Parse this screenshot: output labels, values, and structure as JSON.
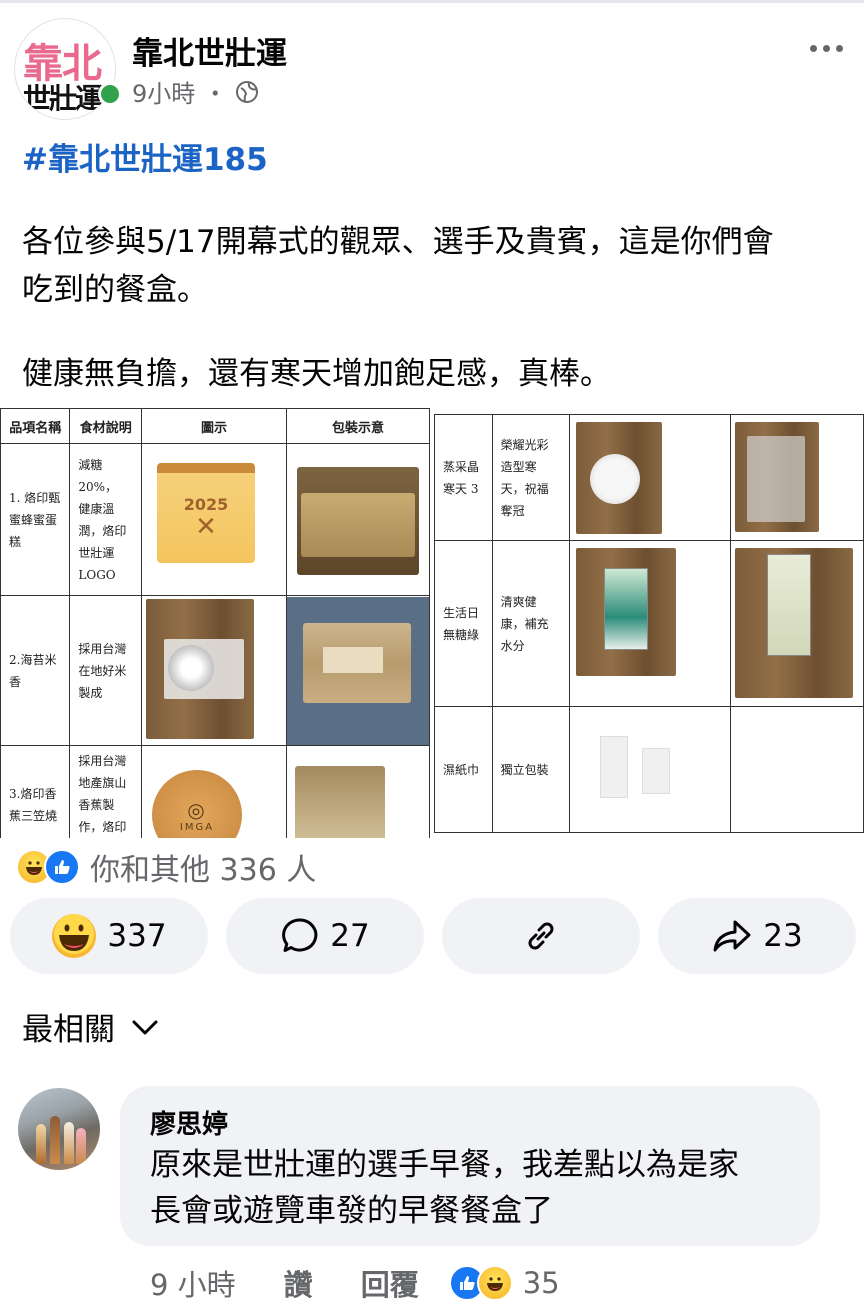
{
  "post": {
    "page_name": "靠北世壯運",
    "avatar_text_top": "靠北",
    "avatar_text_bottom": "世壯運",
    "time": "9小時",
    "dot": "・",
    "hashtag": "#靠北世壯運185",
    "paragraph1": "各位參與5/17開幕式的觀眾、選手及貴賓，這是你們會\n吃到的餐盒。",
    "paragraph2": "健康無負擔，還有寒天增加飽足感，真棒。"
  },
  "image_left": {
    "headers": [
      "品項名稱",
      "食材說明",
      "圖示",
      "包裝示意"
    ],
    "rows": [
      {
        "name": "1. 烙印甄\n蜜蜂蜜蛋糕",
        "desc": "減糖 20%，\n健康溫\n潤，烙印\n世壯運\nLOGO",
        "cake_year": "2025"
      },
      {
        "name": "2.海苔米\n香",
        "desc": "採用台灣\n在地好米\n製成"
      },
      {
        "name": "3.烙印香\n蕉三笠燒",
        "desc": "採用台灣\n地產旗山\n香蕉製\n作，烙印\n「世壯",
        "cake_logo": "IMGA"
      }
    ]
  },
  "image_right": {
    "rows": [
      {
        "name": "蒸采晶\n寒天 3",
        "desc": "榮耀光彩\n造型寒\n天，祝福\n奪冠"
      },
      {
        "name": "生活日\n無糖綠",
        "desc": "清爽健\n康，補充\n水分"
      },
      {
        "name": "濕紙巾",
        "desc": "獨立包裝"
      }
    ]
  },
  "reactions": {
    "summary": "你和其他 336 人",
    "icons": [
      "haha-icon",
      "like-icon"
    ]
  },
  "actions": {
    "reaction_count": "337",
    "comment_count": "27",
    "share_count": "23"
  },
  "filter": {
    "label": "最相關"
  },
  "comment": {
    "author": "廖思婷",
    "text": "原來是世壯運的選手早餐，我差點以為是家\n長會或遊覽車發的早餐餐盒了",
    "time": "9 小時",
    "like_label": "讚",
    "reply_label": "回覆",
    "reaction_count": "35"
  },
  "colors": {
    "hashtag": "#1b64c5",
    "muted": "#65676b",
    "pill_bg": "#f0f2f5",
    "like_blue": "#1877f2",
    "online_green": "#31a24c"
  }
}
